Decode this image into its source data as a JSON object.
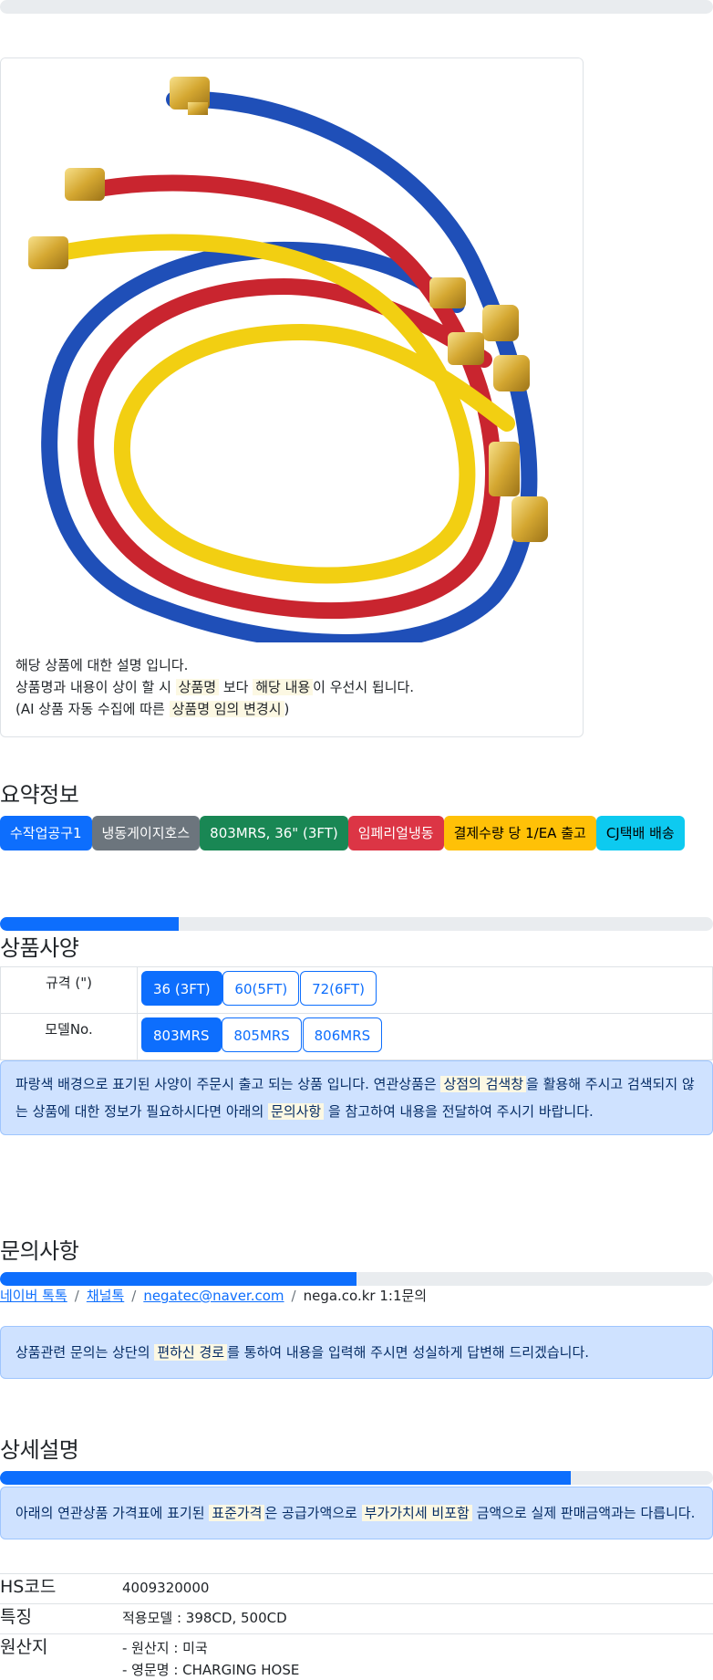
{
  "top_progress": 0,
  "product_card": {
    "image_alt": "냉동게이지호스 803MRS",
    "description_line1": "해당 상품에 대한 설명 입니다.",
    "description_line2_a": "상품명과 내용이 상이 할 시 ",
    "description_line2_mark1": "상품명",
    "description_line2_b": " 보다 ",
    "description_line2_mark2": "해당 내용",
    "description_line2_c": "이 우선시 됩니다.",
    "description_line3_a": "(AI 상품 자동 수집에 따른 ",
    "description_line3_mark": "상품명 임의 변경시",
    "description_line3_b": ")"
  },
  "summary": {
    "title": "요약정보",
    "badges": [
      "수작업공구1",
      "냉동게이지호스",
      "803MRS, 36\" (3FT)",
      "임페리얼냉동",
      "결제수량 당 1/EA 출고",
      "CJ택배 배송"
    ]
  },
  "spec": {
    "progress": 0.25,
    "title": "상품사양",
    "rows": [
      {
        "label": "규격 (\")",
        "options": [
          "36 (3FT)",
          "60(5FT)",
          "72(6FT)"
        ],
        "selected": 0
      },
      {
        "label": "모델No.",
        "options": [
          "803MRS",
          "805MRS",
          "806MRS"
        ],
        "selected": 0
      }
    ],
    "notice_a": "파랑색 배경으로 표기된 사양이 주문시 출고 되는 상품 입니다. 연관상품은 ",
    "notice_mark1": "상점의 검색창",
    "notice_b": "을 활용해 주시고 검색되지 않는 상품에 대한 정보가 필요하시다면 아래의 ",
    "notice_mark2": "문의사항",
    "notice_c": " 을 참고하여 내용을 전달하여 주시기 바랍니다."
  },
  "inquiry": {
    "title": "문의사항",
    "progress": 0.5,
    "links": [
      "네이버 톡톡",
      "채널톡",
      "negatec@naver.com"
    ],
    "plain_item": "nega.co.kr 1:1문의",
    "separator": "/",
    "notice_a": "상품관련 문의는 상단의 ",
    "notice_mark": "편하신 경로",
    "notice_b": "를 통하여 내용을 입력해 주시면 성실하게 답변해 드리겠습니다."
  },
  "detail": {
    "title": "상세설명",
    "progress": 0.8,
    "notice_a": "아래의 연관상품 가격표에 표기된 ",
    "notice_mark1": "표준가격",
    "notice_b": "은 공급가액으로 ",
    "notice_mark2": "부가가치세 비포함",
    "notice_c": " 금액으로 실제 판매금액과는 다릅니다.",
    "rows": [
      {
        "key": "HS코드",
        "values": [
          "4009320000"
        ]
      },
      {
        "key": "특징",
        "values": [
          "적용모델 : 398CD, 500CD"
        ]
      },
      {
        "key": "원산지",
        "values": [
          "- 원산지 : 미국",
          "- 영문명 : CHARGING HOSE"
        ]
      }
    ]
  }
}
